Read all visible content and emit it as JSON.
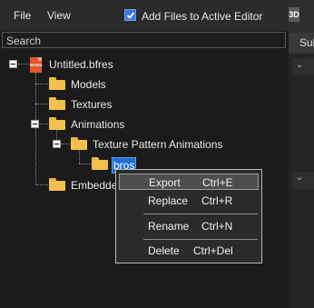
{
  "menu": {
    "file": "File",
    "view": "View"
  },
  "toolbar": {
    "add_files_label": "Add Files to Active Editor",
    "add_files_checked": true
  },
  "right_panel": {
    "badge": "3D",
    "sub_tab": "Sub"
  },
  "search": {
    "placeholder": "Search"
  },
  "tree": {
    "root": {
      "label": "Untitled.bfres",
      "icon_text": "BFRES"
    },
    "models": "Models",
    "textures": "Textures",
    "animations": "Animations",
    "texture_pattern_animations": "Texture Pattern Animations",
    "selected_node": "bros",
    "embedded": "Embedded"
  },
  "context_menu": {
    "items": [
      {
        "label": "Export",
        "shortcut": "Ctrl+E"
      },
      {
        "label": "Replace",
        "shortcut": "Ctrl+R"
      },
      {
        "label": "Rename",
        "shortcut": "Ctrl+N"
      },
      {
        "label": "Delete",
        "shortcut": "Ctrl+Del"
      }
    ]
  },
  "colors": {
    "accent": "#1f6fd6",
    "folder": "#f2c04b",
    "bfres_icon": "#e4572e",
    "background": "#1b1b1b"
  }
}
